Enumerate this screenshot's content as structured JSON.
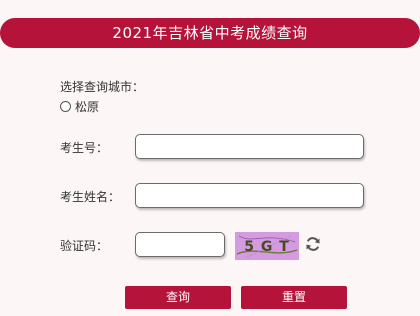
{
  "header": {
    "title": "2021年吉林省中考成绩查询"
  },
  "city": {
    "label": "选择查询城市：",
    "options": [
      "松原"
    ]
  },
  "form": {
    "exam_number_label": "考生号：",
    "exam_number_value": "",
    "name_label": "考生姓名：",
    "name_value": "",
    "code_label": "验证码：",
    "code_value": "",
    "captcha_text": "5 G T"
  },
  "buttons": {
    "query": "查询",
    "reset": "重置"
  },
  "colors": {
    "accent": "#b5133a",
    "background": "#fdf6f6",
    "captcha_bg": "#d49be0"
  },
  "icons": {
    "refresh": "refresh-icon"
  }
}
